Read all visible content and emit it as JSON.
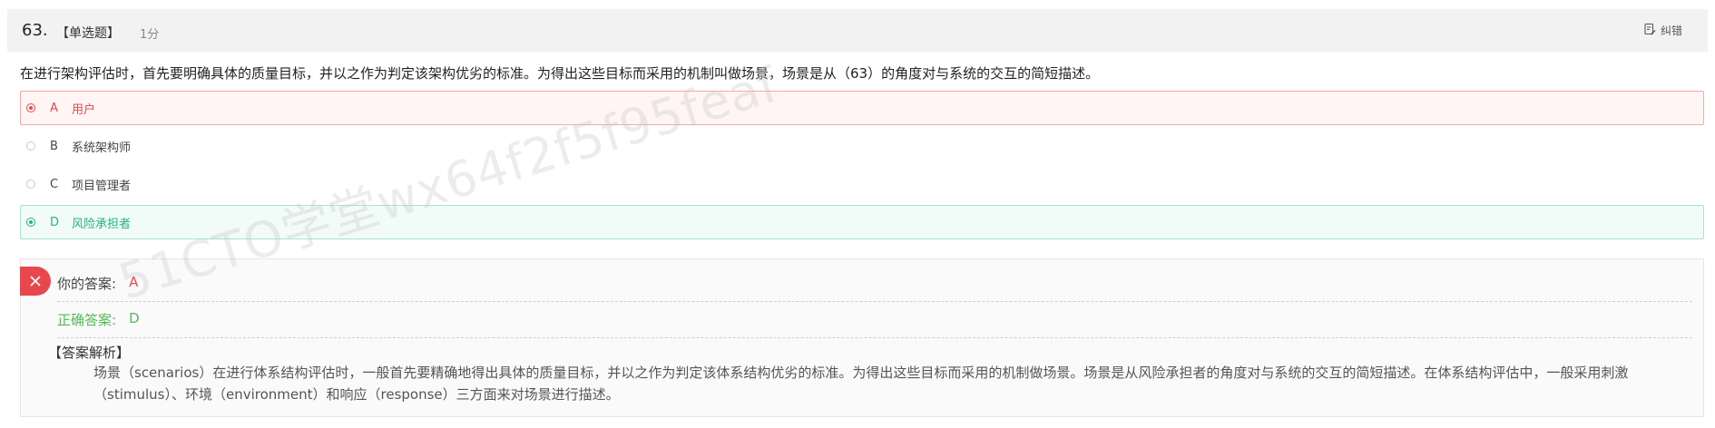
{
  "question": {
    "number": "63.",
    "type": "【单选题】",
    "score": "1分",
    "report_label": "纠错",
    "stem": "在进行架构评估时，首先要明确具体的质量目标，并以之作为判定该架构优劣的标准。为得出这些目标而采用的机制叫做场景，场景是从（63）的角度对与系统的交互的简短描述。"
  },
  "options": [
    {
      "letter": "A",
      "text": "用户",
      "state": "wrong"
    },
    {
      "letter": "B",
      "text": "系统架构师",
      "state": "none"
    },
    {
      "letter": "C",
      "text": "项目管理者",
      "state": "none"
    },
    {
      "letter": "D",
      "text": "风险承担者",
      "state": "correct"
    }
  ],
  "watermark": "51CTO学堂wx64f2f5f95feaf",
  "result": {
    "your_answer_label": "你的答案:",
    "your_answer": "A",
    "correct_answer_label": "正确答案:",
    "correct_answer": "D",
    "analysis_title": "【答案解析】",
    "analysis_text": "场景（scenarios）在进行体系结构评估时，一般首先要精确地得出具体的质量目标，并以之作为判定该体系结构优劣的标准。为得出这些目标而采用的机制做场景。场景是从风险承担者的角度对与系统的交互的简短描述。在体系结构评估中，一般采用刺激（stimulus）、环境（environment）和响应（response）三方面来对场景进行描述。"
  },
  "colors": {
    "wrong": "#e8474d",
    "correct": "#26b08a",
    "correct_answer_text": "#55b95a"
  }
}
